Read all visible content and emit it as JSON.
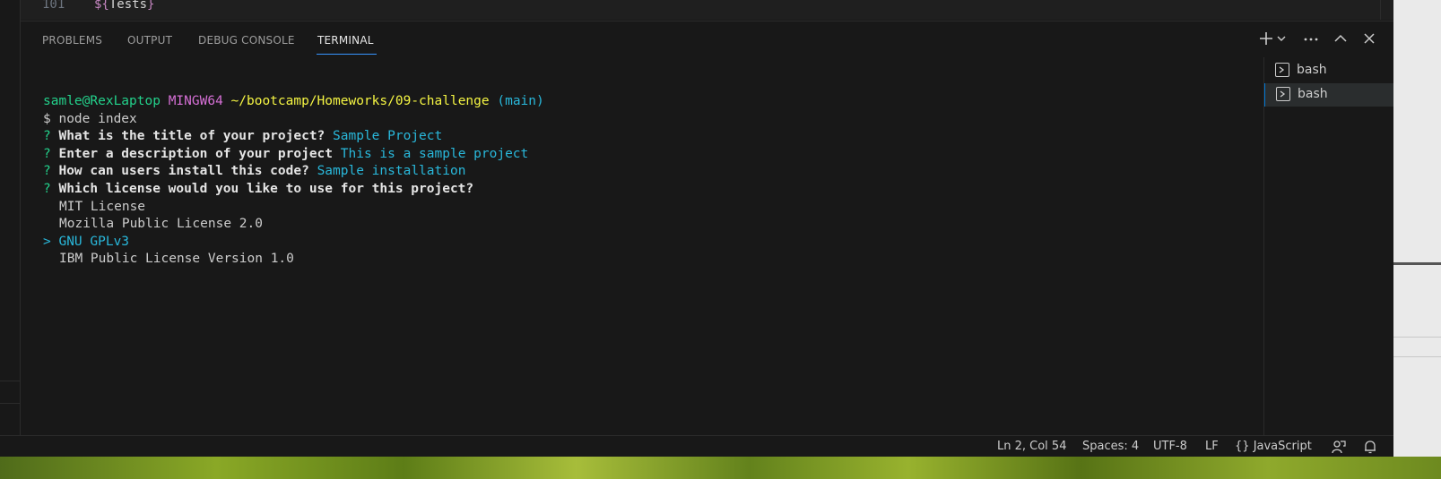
{
  "editor": {
    "line_number": "101",
    "code_prefix": "${",
    "code_word": "Tests",
    "code_suffix": "}"
  },
  "panel": {
    "tabs": [
      {
        "label": "PROBLEMS"
      },
      {
        "label": "OUTPUT"
      },
      {
        "label": "DEBUG CONSOLE"
      },
      {
        "label": "TERMINAL"
      }
    ],
    "active_tab": "TERMINAL",
    "actions": {
      "new_terminal_icon": "plus-icon",
      "dropdown_icon": "chevron-down-icon",
      "more_icon": "ellipsis-icon",
      "maximize_icon": "chevron-up-icon",
      "close_icon": "close-icon"
    }
  },
  "terminal": {
    "prompt_user": "samle@RexLaptop",
    "prompt_env": "MINGW64",
    "prompt_path": "~/bootcamp/Homeworks/09-challenge",
    "prompt_branch": "(main)",
    "command": "$ node index",
    "qa": [
      {
        "mark": "?",
        "question": "What is the title of your project?",
        "answer": "Sample Project"
      },
      {
        "mark": "?",
        "question": "Enter a description of your project",
        "answer": "This is a sample project"
      },
      {
        "mark": "?",
        "question": "How can users install this code?",
        "answer": "Sample installation"
      },
      {
        "mark": "?",
        "question": "Which license would you like to use for this project?",
        "answer": ""
      }
    ],
    "license_options": [
      {
        "label": "MIT License",
        "selected": false
      },
      {
        "label": "Mozilla Public License 2.0",
        "selected": false
      },
      {
        "label": "GNU GPLv3",
        "selected": true
      },
      {
        "label": "IBM Public License Version 1.0",
        "selected": false
      }
    ],
    "cursor": ">"
  },
  "terminal_list": [
    {
      "name": "bash",
      "icon": "terminal-icon",
      "selected": false
    },
    {
      "name": "bash",
      "icon": "terminal-icon",
      "selected": true
    }
  ],
  "status_bar": {
    "position": "Ln 2, Col 54",
    "spaces": "Spaces: 4",
    "encoding": "UTF-8",
    "eol": "LF",
    "language_icon": "braces-icon",
    "language_braces": "{}",
    "language": "JavaScript",
    "feedback_icon": "feedback-icon",
    "notifications_icon": "bell-icon"
  },
  "colors": {
    "accent": "#3794ff",
    "terminal_green": "#23d18b",
    "terminal_magenta": "#d670d6",
    "terminal_yellow": "#f5f543",
    "terminal_cyan": "#29b8db",
    "background": "#181818"
  }
}
